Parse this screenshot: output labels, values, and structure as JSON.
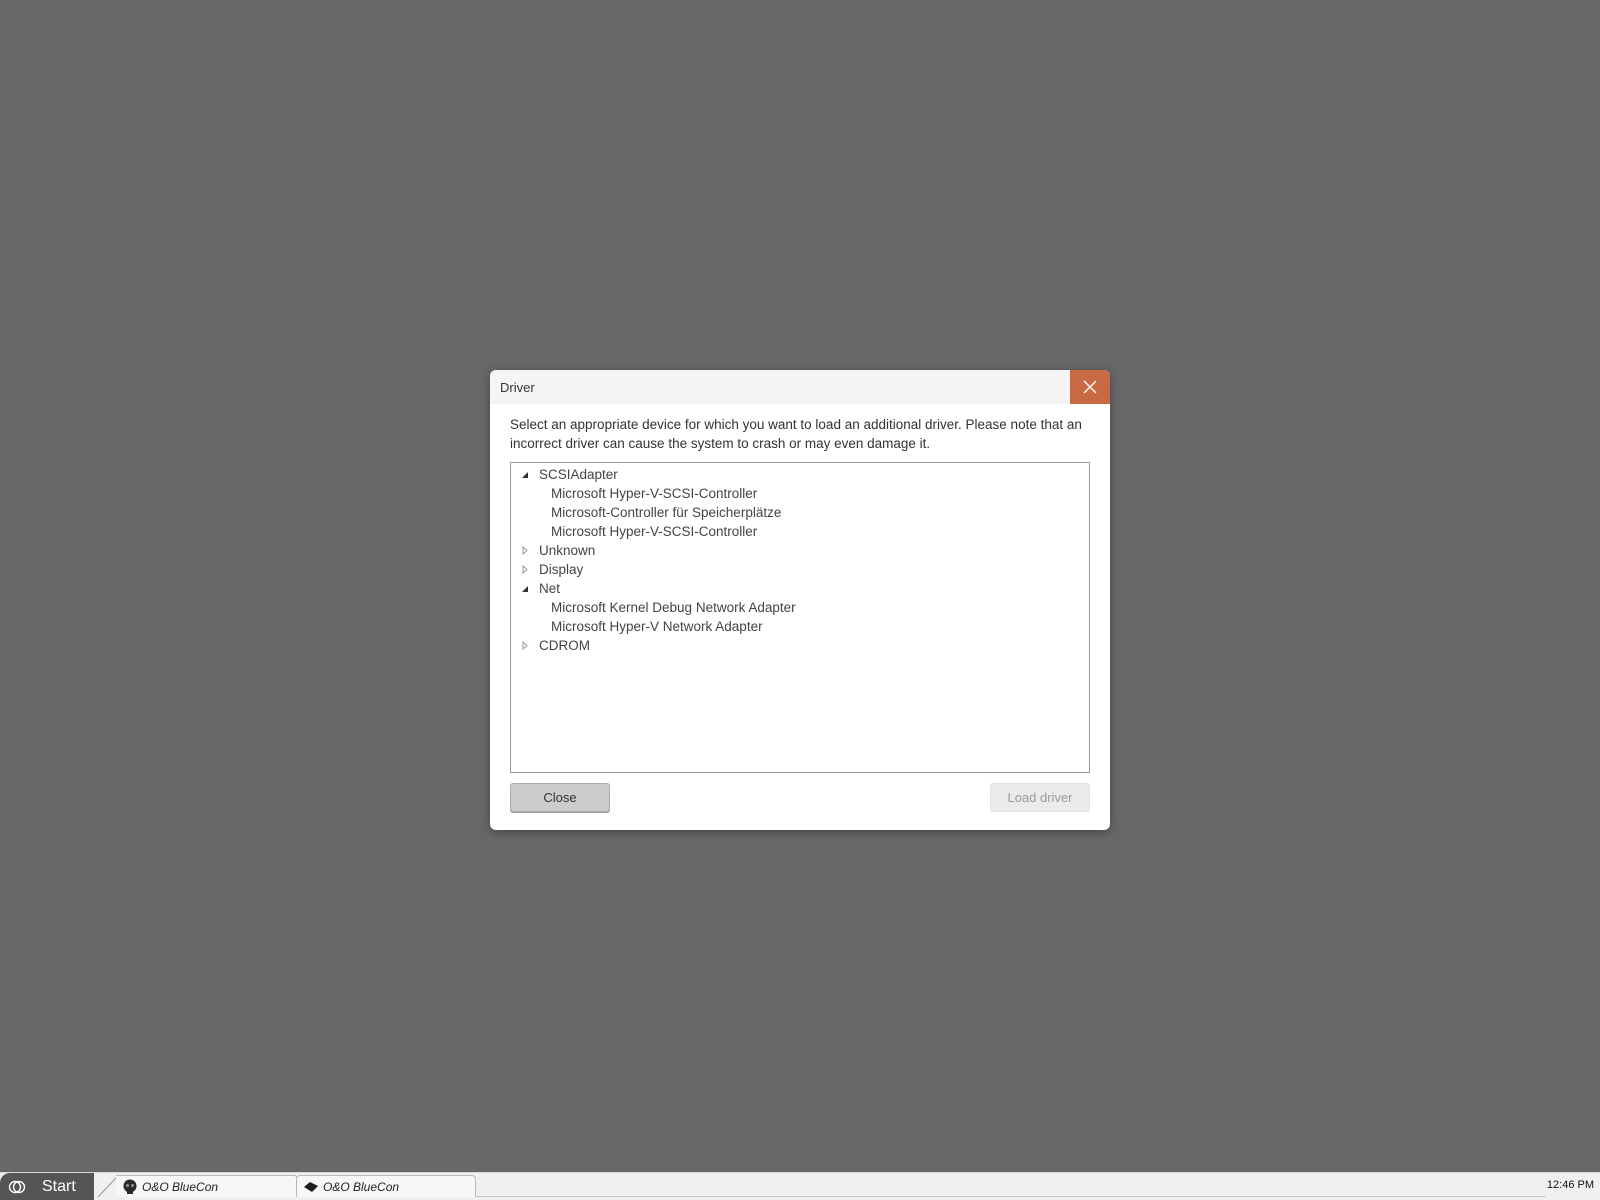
{
  "dialog": {
    "title": "Driver",
    "close_icon": "close-icon",
    "description": "Select an appropriate device for which you want to load an additional driver. Please note that an incorrect driver can cause the system to crash or may even damage it.",
    "tree": [
      {
        "label": "SCSIAdapter",
        "expanded": true,
        "children": [
          "Microsoft Hyper-V-SCSI-Controller",
          "Microsoft-Controller für Speicherplätze",
          "Microsoft Hyper-V-SCSI-Controller"
        ]
      },
      {
        "label": "Unknown",
        "expanded": false,
        "children": []
      },
      {
        "label": "Display",
        "expanded": false,
        "children": []
      },
      {
        "label": "Net",
        "expanded": true,
        "children": [
          "Microsoft Kernel Debug Network Adapter",
          "Microsoft Hyper-V Network Adapter"
        ]
      },
      {
        "label": "CDROM",
        "expanded": false,
        "children": []
      }
    ],
    "buttons": {
      "close": "Close",
      "load_driver": "Load driver",
      "load_driver_enabled": false
    },
    "accent_color": "#c86a44"
  },
  "taskbar": {
    "start_label": "Start",
    "start_icon": "start-logo-icon",
    "tasks": [
      {
        "label": "O&O BlueCon",
        "icon": "bluecon-skull-icon"
      },
      {
        "label": "O&O BlueCon",
        "icon": "bluecon-diamond-icon"
      }
    ],
    "clock": "12:46 PM"
  }
}
